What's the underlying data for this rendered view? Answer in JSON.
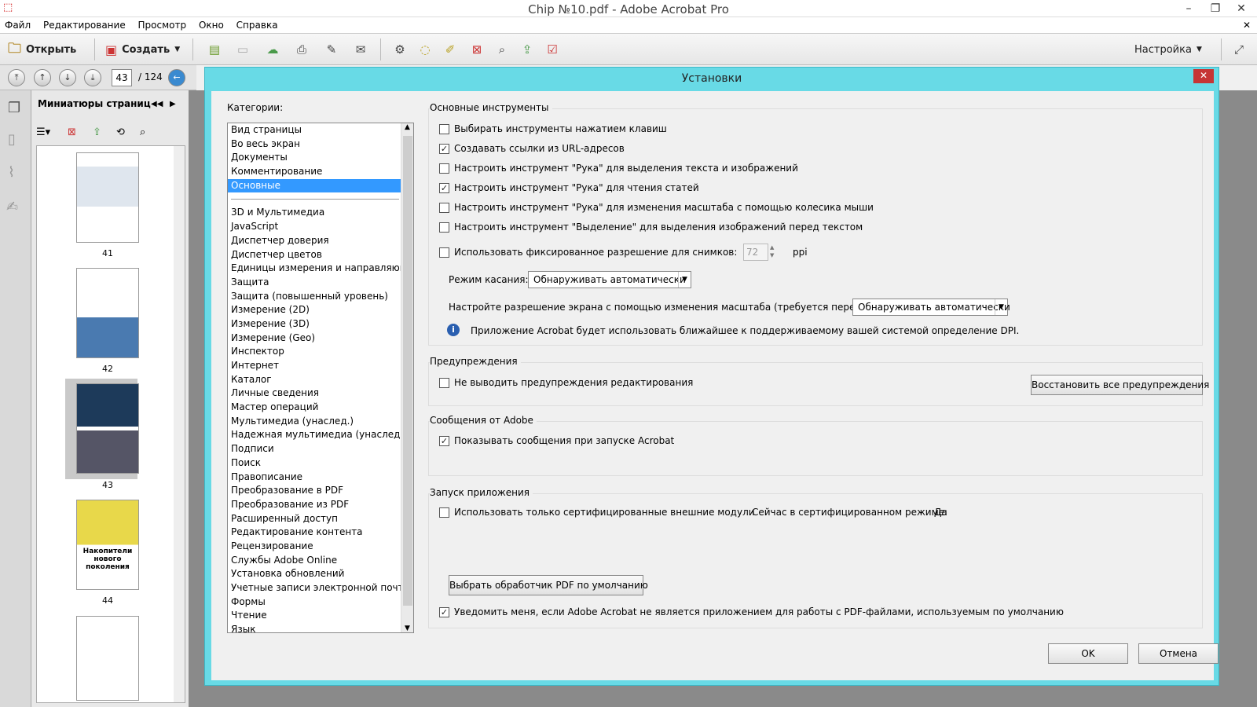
{
  "window": {
    "title": "Chip №10.pdf - Adobe Acrobat Pro",
    "min": "–",
    "max": "❐",
    "close": "✕"
  },
  "menu": [
    "Файл",
    "Редактирование",
    "Просмотр",
    "Окно",
    "Справка"
  ],
  "toolbar": {
    "open": "Открыть",
    "create": "Создать",
    "settings": "Настройка"
  },
  "nav": {
    "page": "43",
    "total": "/ 124"
  },
  "thumbs": {
    "header": "Миниатюры страниц",
    "pages": [
      "41",
      "42",
      "43",
      "44"
    ],
    "thumb3_caption": "Накопители нового поколения"
  },
  "dialog": {
    "title": "Установки",
    "close": "✕",
    "categories_label": "Категории:",
    "categories_top": [
      "Вид страницы",
      "Во весь экран",
      "Документы",
      "Комментирование",
      "Основные"
    ],
    "categories": [
      "3D и Мультимедиа",
      "JavaScript",
      "Диспетчер доверия",
      "Диспетчер цветов",
      "Единицы измерения и направляющие",
      "Защита",
      "Защита (повышенный уровень)",
      "Измерение (2D)",
      "Измерение (3D)",
      "Измерение (Geo)",
      "Инспектор",
      "Интернет",
      "Каталог",
      "Личные сведения",
      "Мастер операций",
      "Мультимедиа (унаслед.)",
      "Надежная мультимедиа (унаслед.)",
      "Подписи",
      "Поиск",
      "Правописание",
      "Преобразование в PDF",
      "Преобразование из PDF",
      "Расширенный доступ",
      "Редактирование контента",
      "Рецензирование",
      "Службы Adobe Online",
      "Установка обновлений",
      "Учетные записи электронной почты",
      "Формы",
      "Чтение",
      "Язык"
    ],
    "basic_tools": {
      "title": "Основные инструменты",
      "cb1": "Выбирать инструменты нажатием клавиш",
      "cb2": "Создавать ссылки из URL-адресов",
      "cb3": "Настроить инструмент \"Рука\" для выделения текста и изображений",
      "cb4": "Настроить инструмент \"Рука\" для чтения статей",
      "cb5": "Настроить инструмент \"Рука\" для изменения масштаба с помощью колесика мыши",
      "cb6": "Настроить инструмент \"Выделение\" для выделения изображений перед текстом",
      "cb7": "Использовать фиксированное разрешение для снимков:",
      "ppi_value": "72",
      "ppi_unit": "ppi",
      "touch_label": "Режим касания:",
      "touch_value": "Обнаруживать автоматически",
      "scale_label": "Настройте разрешение экрана с помощью изменения масштаба (требуется перезагрузка)",
      "scale_value": "Обнаруживать автоматически",
      "info": "Приложение Acrobat будет использовать ближайшее к поддерживаемому вашей системой определение DPI."
    },
    "warnings": {
      "title": "Предупреждения",
      "cb": "Не выводить предупреждения редактирования",
      "restore": "Восстановить все предупреждения"
    },
    "adobe_msgs": {
      "title": "Сообщения от Adobe",
      "cb": "Показывать сообщения при запуске Acrobat"
    },
    "launch": {
      "title": "Запуск приложения",
      "cb": "Использовать только сертифицированные внешние модули",
      "cert_label": "Сейчас в сертифицированном режиме:",
      "cert_value": "Да",
      "default_btn": "Выбрать обработчик PDF по умолчанию",
      "notify": "Уведомить меня, если Adobe Acrobat не является приложением для работы с PDF-файлами, используемым по умолчанию"
    },
    "ok": "OK",
    "cancel": "Отмена"
  },
  "checkmark": "✓",
  "colors": {
    "dialog_frame": "#68dae6",
    "selection": "#3399ff"
  }
}
